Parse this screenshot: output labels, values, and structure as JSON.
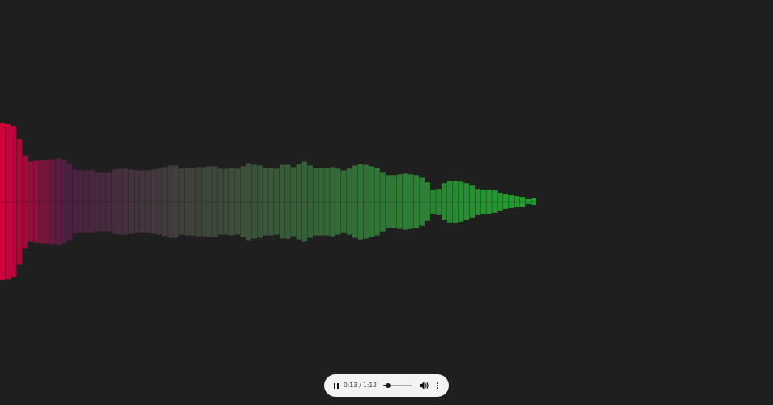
{
  "colors": {
    "background": "#1f1f1f",
    "gradient_start": "#d0003a",
    "gradient_mid": "#4a2040",
    "gradient_end": "#22a030"
  },
  "player": {
    "time": "0:13 / 1:12",
    "progress_fraction": 0.18,
    "play_state": "playing",
    "pause_icon": "pause-icon",
    "volume_icon": "volume-icon",
    "more_icon": "more-vertical-icon"
  },
  "visualizer": {
    "bar_count": 96,
    "heights": [
      0.98,
      0.97,
      0.94,
      0.78,
      0.58,
      0.5,
      0.51,
      0.52,
      0.52,
      0.53,
      0.54,
      0.52,
      0.48,
      0.4,
      0.39,
      0.39,
      0.39,
      0.37,
      0.37,
      0.37,
      0.4,
      0.41,
      0.41,
      0.4,
      0.39,
      0.39,
      0.39,
      0.4,
      0.41,
      0.43,
      0.45,
      0.45,
      0.41,
      0.42,
      0.42,
      0.43,
      0.43,
      0.44,
      0.44,
      0.41,
      0.41,
      0.42,
      0.41,
      0.44,
      0.48,
      0.46,
      0.45,
      0.42,
      0.42,
      0.41,
      0.46,
      0.46,
      0.43,
      0.47,
      0.5,
      0.45,
      0.42,
      0.42,
      0.42,
      0.43,
      0.41,
      0.39,
      0.41,
      0.45,
      0.47,
      0.46,
      0.44,
      0.42,
      0.37,
      0.33,
      0.33,
      0.34,
      0.35,
      0.34,
      0.33,
      0.3,
      0.24,
      0.15,
      0.16,
      0.23,
      0.26,
      0.26,
      0.25,
      0.23,
      0.2,
      0.16,
      0.15,
      0.15,
      0.14,
      0.11,
      0.09,
      0.08,
      0.07,
      0.06,
      0.03,
      0.04
    ]
  }
}
